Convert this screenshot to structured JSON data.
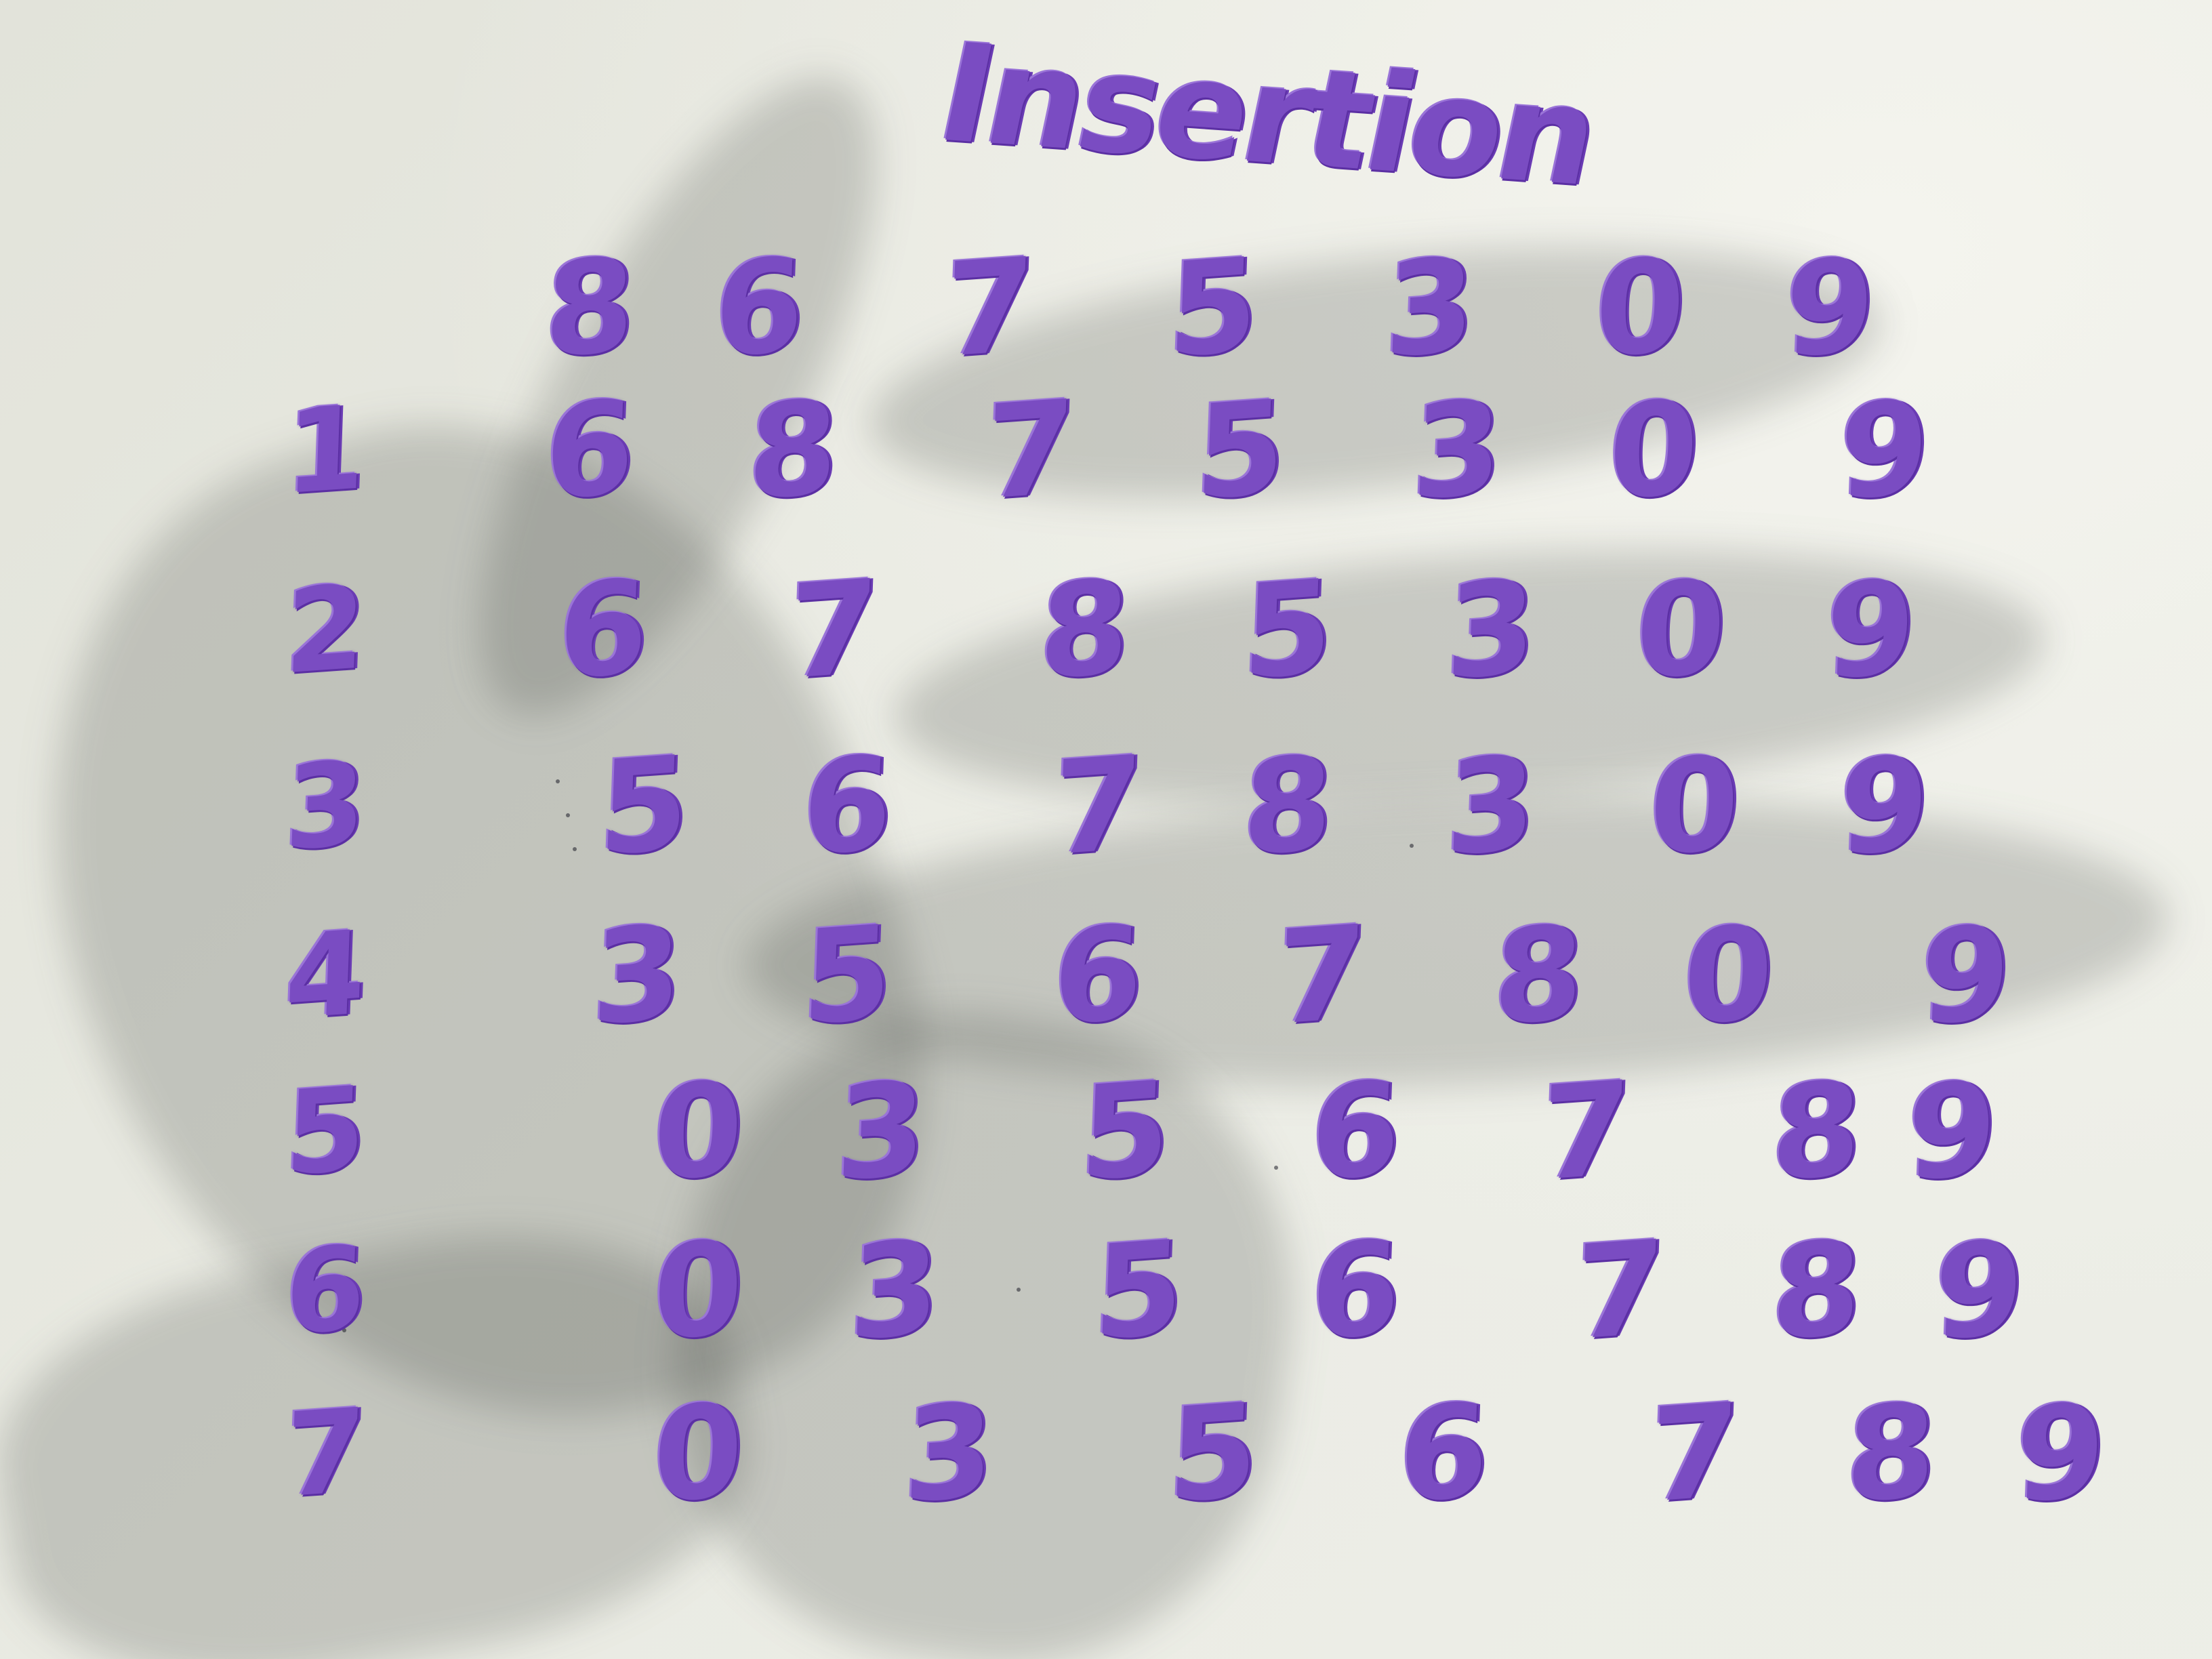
{
  "title": "Insertion",
  "header_row": [
    "8",
    "6",
    "7",
    "5",
    "3",
    "0",
    "9"
  ],
  "rows": [
    {
      "label": "1",
      "values": [
        "6",
        "8",
        "7",
        "5",
        "3",
        "0",
        "9"
      ]
    },
    {
      "label": "2",
      "values": [
        "6",
        "7",
        "8",
        "5",
        "3",
        "0",
        "9"
      ]
    },
    {
      "label": "3",
      "values": [
        "5",
        "6",
        "7",
        "8",
        "3",
        "0",
        "9"
      ]
    },
    {
      "label": "4",
      "values": [
        "3",
        "5",
        "6",
        "7",
        "8",
        "0",
        "9"
      ]
    },
    {
      "label": "5",
      "values": [
        "0",
        "3",
        "5",
        "6",
        "7",
        "8",
        "9"
      ]
    },
    {
      "label": "6",
      "values": [
        "0",
        "3",
        "5",
        "6",
        "7",
        "8",
        "9"
      ]
    },
    {
      "label": "7",
      "values": [
        "0",
        "3",
        "5",
        "6",
        "7",
        "8",
        "9"
      ]
    }
  ],
  "colors": {
    "marker": "#7a4cc2",
    "board": "#e9eae2"
  }
}
